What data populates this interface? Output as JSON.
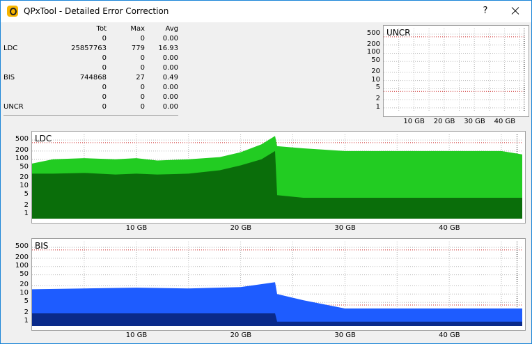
{
  "window": {
    "title": "QPxTool - Detailed Error Correction",
    "help_label": "?",
    "title_color": "#000000"
  },
  "stats": {
    "headers": [
      "",
      "Tot",
      "Max",
      "Avg"
    ],
    "rows": [
      [
        "",
        "0",
        "0",
        "0.00"
      ],
      [
        "LDC",
        "25857763",
        "779",
        "16.93"
      ],
      [
        "",
        "0",
        "0",
        "0.00"
      ],
      [
        "",
        "0",
        "0",
        "0.00"
      ],
      [
        "BIS",
        "744868",
        "27",
        "0.49"
      ],
      [
        "",
        "0",
        "0",
        "0.00"
      ],
      [
        "",
        "0",
        "0",
        "0.00"
      ],
      [
        "UNCR",
        "0",
        "0",
        "0.00"
      ]
    ]
  },
  "colors": {
    "ldc_light": "#22cc22",
    "ldc_dark": "#0a6e0a",
    "bis_light": "#1e5cff",
    "bis_dark": "#0a2a8a",
    "threshold": "#cc2222",
    "grid": "#b8b8b8"
  },
  "chart_data": [
    {
      "type": "area",
      "title": "UNCR",
      "yscale": "log",
      "y_ticks": [
        "500",
        "200",
        "100",
        "50",
        "20",
        "10",
        "5",
        "2",
        "1"
      ],
      "x_ticks": [
        "10 GB",
        "20 GB",
        "30 GB",
        "40 GB"
      ],
      "series": []
    },
    {
      "type": "area",
      "title": "LDC",
      "yscale": "log",
      "y_ticks": [
        "500",
        "200",
        "100",
        "50",
        "20",
        "10",
        "5",
        "2",
        "1"
      ],
      "x_ticks": [
        "10 GB",
        "20 GB",
        "30 GB",
        "40 GB"
      ],
      "xlim": [
        0,
        47
      ],
      "series": [
        {
          "x": [
            0,
            2,
            5,
            8,
            10,
            12,
            15,
            18,
            20,
            22,
            23.3,
            23.5,
            26,
            30,
            35,
            40,
            45,
            47
          ],
          "max": [
            70,
            100,
            110,
            100,
            110,
            90,
            100,
            120,
            180,
            350,
            700,
            300,
            250,
            200,
            200,
            200,
            200,
            150
          ],
          "avg": [
            30,
            30,
            32,
            28,
            30,
            28,
            30,
            40,
            60,
            100,
            200,
            5,
            4,
            4,
            4,
            4,
            4,
            4
          ]
        }
      ]
    },
    {
      "type": "area",
      "title": "BIS",
      "yscale": "log",
      "y_ticks": [
        "500",
        "200",
        "100",
        "50",
        "20",
        "10",
        "5",
        "2",
        "1"
      ],
      "x_ticks": [
        "10 GB",
        "20 GB",
        "30 GB",
        "40 GB"
      ],
      "xlim": [
        0,
        47
      ],
      "series": [
        {
          "x": [
            0,
            5,
            10,
            15,
            20,
            23.3,
            23.5,
            26,
            30,
            35,
            40,
            45,
            47
          ],
          "max": [
            15,
            16,
            17,
            16,
            18,
            27,
            10,
            6,
            3,
            3,
            3,
            3,
            3
          ],
          "avg": [
            2,
            2,
            2,
            2,
            2,
            2,
            1,
            1,
            1,
            1,
            1,
            1,
            1
          ]
        }
      ]
    }
  ]
}
